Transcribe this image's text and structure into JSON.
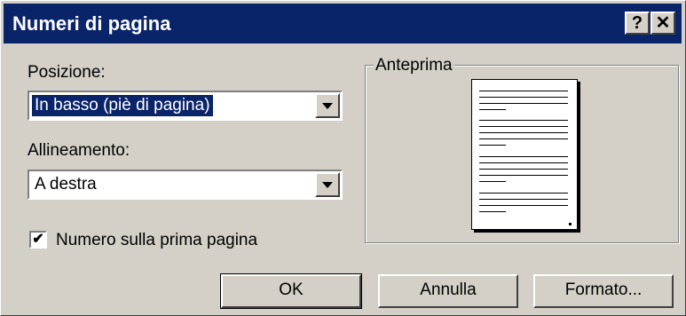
{
  "dialog": {
    "title": "Numeri di pagina",
    "help_button": "?",
    "close_button": "✕"
  },
  "position": {
    "label": "Posizione:",
    "value": "In basso (piè di pagina)"
  },
  "alignment": {
    "label": "Allineamento:",
    "value": "A destra"
  },
  "first_page_checkbox": {
    "label": "Numero sulla prima pagina",
    "checked": true,
    "mark": "✔"
  },
  "preview": {
    "label": "Anteprima"
  },
  "buttons": {
    "ok": "OK",
    "cancel": "Annulla",
    "format": "Formato..."
  }
}
